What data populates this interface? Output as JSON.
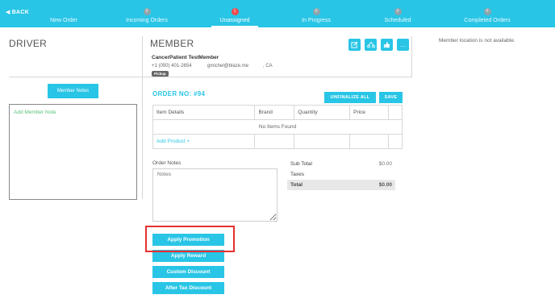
{
  "nav": {
    "back_label": "BACK",
    "tabs": [
      {
        "label": "New Order",
        "badge": ""
      },
      {
        "label": "Incoming Orders",
        "badge": "0"
      },
      {
        "label": "Unassigned",
        "badge": "1"
      },
      {
        "label": "In Progress",
        "badge": "0"
      },
      {
        "label": "Scheduled",
        "badge": "0"
      },
      {
        "label": "Completed Orders",
        "badge": "0"
      }
    ],
    "active_color": "#29c5e6"
  },
  "driver": {
    "title": "DRIVER"
  },
  "member": {
    "title": "MEMBER",
    "name": "CancerPatient TestMember",
    "phone": "+1 (050) 401-2654",
    "email": "gmichel@blaze.me",
    "location": ", CA",
    "pickup_badge": "Pickup",
    "icons": [
      "edit-icon",
      "transfer-icon",
      "thumbs-up-icon",
      "more-icon"
    ],
    "location_note": "Member location is not available.",
    "notes_button": "Member Notes",
    "notes_placeholder": "Add Member Note"
  },
  "order": {
    "title": "ORDER NO: #94",
    "unfinalize_label": "UNFINALIZE ALL",
    "save_label": "SAVE",
    "columns": [
      "Item Details",
      "Brand",
      "Quantity",
      "Price"
    ],
    "empty_text": "No Items Found",
    "add_product_label": "Add Product +",
    "notes_label": "Order Notes",
    "notes_placeholder": "Notes",
    "subtotal_label": "Sub Total",
    "subtotal_value": "$0.00",
    "taxes_label": "Taxes",
    "total_label": "Total",
    "total_value": "$0.00"
  },
  "actions": {
    "apply_promotion": "Apply Promotion",
    "apply_reward": "Apply Reward",
    "custom_discount": "Custom Discount",
    "after_tax_discount": "After Tax Discount"
  },
  "highlight_color": "#e53030"
}
